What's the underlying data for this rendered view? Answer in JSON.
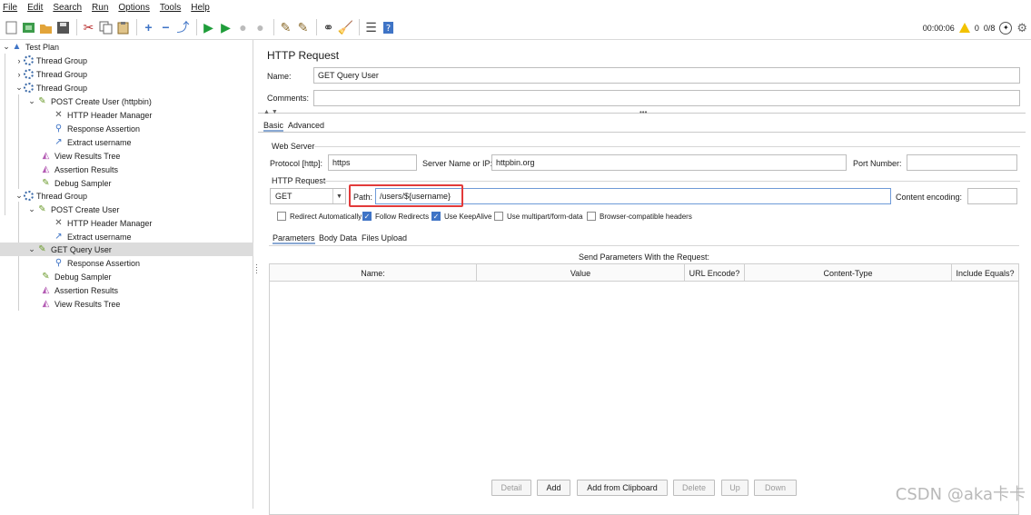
{
  "menu": [
    "File",
    "Edit",
    "Search",
    "Run",
    "Options",
    "Tools",
    "Help"
  ],
  "status": {
    "elapsed": "00:00:06",
    "warnings": "0",
    "threads": "0/8"
  },
  "tree": [
    {
      "label": "Test Plan",
      "icon": "test-plan-icon"
    },
    {
      "label": "Thread Group",
      "icon": "gear-icon"
    },
    {
      "label": "Thread Group",
      "icon": "gear-icon"
    },
    {
      "label": "Thread Group",
      "icon": "gear-icon"
    },
    {
      "label": "POST Create User (httpbin)",
      "icon": "sampler-icon"
    },
    {
      "label": "HTTP Header Manager",
      "icon": "tools-icon"
    },
    {
      "label": "Response Assertion",
      "icon": "magnifier-icon"
    },
    {
      "label": "Extract username",
      "icon": "extractor-icon"
    },
    {
      "label": "View Results Tree",
      "icon": "listener-icon"
    },
    {
      "label": "Assertion Results",
      "icon": "listener-icon"
    },
    {
      "label": "Debug Sampler",
      "icon": "sampler-icon"
    },
    {
      "label": "Thread Group",
      "icon": "gear-icon"
    },
    {
      "label": "POST Create User",
      "icon": "sampler-icon"
    },
    {
      "label": "HTTP Header Manager",
      "icon": "tools-icon"
    },
    {
      "label": "Extract username",
      "icon": "extractor-icon"
    },
    {
      "label": "GET Query User",
      "icon": "sampler-icon"
    },
    {
      "label": "Response Assertion",
      "icon": "magnifier-icon"
    },
    {
      "label": "Debug Sampler",
      "icon": "sampler-icon"
    },
    {
      "label": "Assertion Results",
      "icon": "listener-icon"
    },
    {
      "label": "View Results Tree",
      "icon": "listener-icon"
    }
  ],
  "panel": {
    "title": "HTTP Request",
    "name_label": "Name:",
    "name_value": "GET Query User",
    "comments_label": "Comments:",
    "comments_value": "",
    "tabs": [
      "Basic",
      "Advanced"
    ],
    "web_server": "Web Server",
    "protocol_label": "Protocol [http]:",
    "protocol_value": "https",
    "server_label": "Server Name or IP:",
    "server_value": "httpbin.org",
    "port_label": "Port Number:",
    "port_value": "",
    "http_request": "HTTP Request",
    "method": "GET",
    "path_label": "Path:",
    "path_value": "/users/${username}",
    "encoding_label": "Content encoding:",
    "encoding_value": "",
    "checks": [
      {
        "label": "Redirect Automatically",
        "checked": false
      },
      {
        "label": "Follow Redirects",
        "checked": true
      },
      {
        "label": "Use KeepAlive",
        "checked": true
      },
      {
        "label": "Use multipart/form-data",
        "checked": false
      },
      {
        "label": "Browser-compatible headers",
        "checked": false
      }
    ],
    "subtabs": [
      "Parameters",
      "Body Data",
      "Files Upload"
    ],
    "table_caption": "Send Parameters With the Request:",
    "columns": [
      "Name:",
      "Value",
      "URL Encode?",
      "Content-Type",
      "Include Equals?"
    ],
    "buttons": {
      "detail": "Detail",
      "add": "Add",
      "add_clipboard": "Add from Clipboard",
      "delete": "Delete",
      "up": "Up",
      "down": "Down"
    }
  },
  "watermark": "CSDN @aka卡卡",
  "colors": {
    "highlight": "#e23a3a",
    "accent": "#3f74c6"
  }
}
